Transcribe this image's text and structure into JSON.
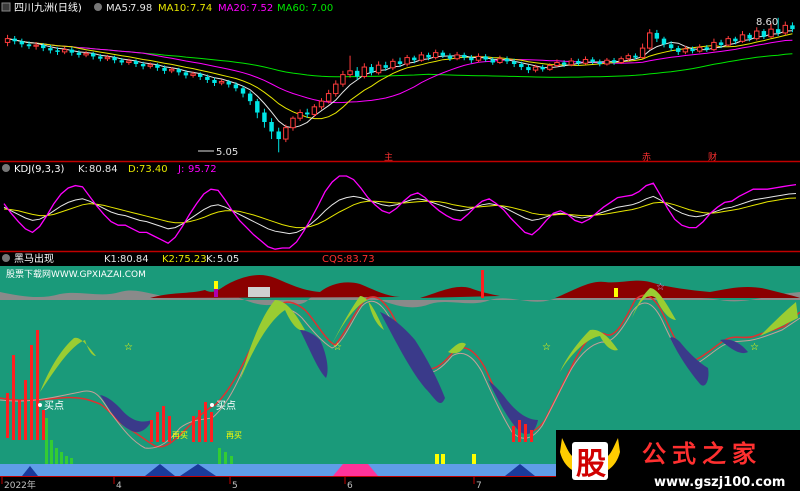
{
  "colors": {
    "up": "#ff3c3c",
    "down": "#00e6e6",
    "ma5": "#e6e6e6",
    "ma10": "#e6e600",
    "ma20": "#ff00ff",
    "ma60": "#00e600",
    "divider": "#c00000",
    "teal": "#1a9a7a",
    "maroon": "#8b0000"
  },
  "price_panel": {
    "security": "四川九洲(日线)",
    "ma_labels": [
      {
        "name": "MA5:",
        "value": "7.98"
      },
      {
        "name": "MA10:",
        "value": "7.74"
      },
      {
        "name": "MA20:",
        "value": "7.52"
      },
      {
        "name": "MA60:",
        "value": "7.00"
      }
    ],
    "high_label": "8.60",
    "low_label": "5.05",
    "markers": [
      "主",
      "赤",
      "财"
    ]
  },
  "kdj_panel": {
    "title": "KDJ(9,3,3)",
    "values": [
      {
        "name": "K:",
        "value": "80.84"
      },
      {
        "name": "D:",
        "value": "73.40"
      },
      {
        "name": "J:",
        "value": "95.72"
      }
    ]
  },
  "horse_panel": {
    "title": "黑马出现",
    "values": [
      {
        "name": "K1:",
        "value": "80.84"
      },
      {
        "name": "K2:",
        "value": "75.23"
      },
      {
        "name": "K:",
        "value": "5.05"
      },
      {
        "name": "CQS:",
        "value": "83.73"
      }
    ],
    "source": "股票下载网WWW.GPXIAZAI.COM",
    "buy_labels": [
      "买点",
      "买点"
    ],
    "small_labels": [
      "再买",
      "再买"
    ]
  },
  "x_axis": {
    "labels": [
      "2022年",
      "4",
      "5",
      "6",
      "7"
    ]
  },
  "watermark": {
    "logo_char": "股",
    "name": "公式之家",
    "url": "www.gszj100.com"
  },
  "chart_data": [
    {
      "type": "candlestick",
      "security": "四川九洲(日线)",
      "period": "日线",
      "indicators": {
        "MA5": 7.98,
        "MA10": 7.74,
        "MA20": 7.52,
        "MA60": 7.0
      },
      "ylim": [
        4.9,
        8.7
      ],
      "annotations": [
        {
          "label": "8.60",
          "value": 8.6
        },
        {
          "label": "5.05",
          "value": 5.05
        }
      ],
      "candles": [
        [
          7.95,
          8.05,
          8.15,
          7.85
        ],
        [
          8.05,
          7.98,
          8.12,
          7.9
        ],
        [
          7.98,
          7.9,
          8.05,
          7.82
        ],
        [
          7.9,
          7.85,
          7.98,
          7.78
        ],
        [
          7.85,
          7.88,
          7.96,
          7.76
        ],
        [
          7.88,
          7.8,
          7.93,
          7.72
        ],
        [
          7.8,
          7.74,
          7.88,
          7.66
        ],
        [
          7.74,
          7.7,
          7.82,
          7.62
        ],
        [
          7.7,
          7.76,
          7.84,
          7.64
        ],
        [
          7.76,
          7.68,
          7.82,
          7.6
        ],
        [
          7.68,
          7.62,
          7.74,
          7.55
        ],
        [
          7.62,
          7.66,
          7.72,
          7.56
        ],
        [
          7.66,
          7.58,
          7.7,
          7.5
        ],
        [
          7.58,
          7.52,
          7.64,
          7.45
        ],
        [
          7.52,
          7.56,
          7.62,
          7.46
        ],
        [
          7.56,
          7.48,
          7.6,
          7.4
        ],
        [
          7.48,
          7.42,
          7.54,
          7.35
        ],
        [
          7.42,
          7.46,
          7.52,
          7.36
        ],
        [
          7.46,
          7.38,
          7.5,
          7.3
        ],
        [
          7.38,
          7.32,
          7.44,
          7.24
        ],
        [
          7.32,
          7.36,
          7.42,
          7.26
        ],
        [
          7.36,
          7.28,
          7.4,
          7.2
        ],
        [
          7.28,
          7.2,
          7.34,
          7.12
        ],
        [
          7.2,
          7.24,
          7.3,
          7.14
        ],
        [
          7.24,
          7.16,
          7.28,
          7.08
        ],
        [
          7.16,
          7.08,
          7.22,
          7.0
        ],
        [
          7.08,
          7.12,
          7.18,
          7.02
        ],
        [
          7.12,
          7.04,
          7.16,
          6.96
        ],
        [
          7.04,
          6.96,
          7.1,
          6.88
        ],
        [
          6.96,
          6.88,
          7.02,
          6.8
        ],
        [
          6.88,
          6.92,
          6.98,
          6.82
        ],
        [
          6.92,
          6.84,
          6.96,
          6.76
        ],
        [
          6.84,
          6.74,
          6.9,
          6.66
        ],
        [
          6.74,
          6.6,
          6.8,
          6.5
        ],
        [
          6.6,
          6.4,
          6.66,
          6.3
        ],
        [
          6.4,
          6.1,
          6.46,
          5.95
        ],
        [
          6.1,
          5.85,
          6.2,
          5.7
        ],
        [
          5.85,
          5.6,
          5.95,
          5.4
        ],
        [
          5.6,
          5.4,
          5.7,
          5.05
        ],
        [
          5.4,
          5.7,
          5.78,
          5.32
        ],
        [
          5.7,
          5.95,
          6.0,
          5.62
        ],
        [
          5.95,
          6.1,
          6.18,
          5.88
        ],
        [
          6.1,
          6.05,
          6.2,
          5.96
        ],
        [
          6.05,
          6.25,
          6.32,
          5.98
        ],
        [
          6.25,
          6.4,
          6.48,
          6.18
        ],
        [
          6.4,
          6.6,
          6.7,
          6.34
        ],
        [
          6.6,
          6.85,
          6.95,
          6.52
        ],
        [
          6.85,
          7.1,
          7.2,
          6.78
        ],
        [
          7.1,
          7.2,
          7.6,
          7.02
        ],
        [
          7.2,
          7.05,
          7.3,
          6.96
        ],
        [
          7.05,
          7.3,
          7.4,
          7.0
        ],
        [
          7.3,
          7.15,
          7.38,
          7.08
        ],
        [
          7.15,
          7.35,
          7.45,
          7.1
        ],
        [
          7.35,
          7.28,
          7.44,
          7.2
        ],
        [
          7.28,
          7.45,
          7.52,
          7.22
        ],
        [
          7.45,
          7.38,
          7.55,
          7.3
        ],
        [
          7.38,
          7.55,
          7.62,
          7.32
        ],
        [
          7.55,
          7.48,
          7.6,
          7.4
        ],
        [
          7.48,
          7.62,
          7.7,
          7.44
        ],
        [
          7.62,
          7.55,
          7.68,
          7.48
        ],
        [
          7.55,
          7.68,
          7.76,
          7.5
        ],
        [
          7.68,
          7.6,
          7.74,
          7.54
        ],
        [
          7.6,
          7.52,
          7.66,
          7.46
        ],
        [
          7.52,
          7.62,
          7.7,
          7.48
        ],
        [
          7.62,
          7.55,
          7.68,
          7.48
        ],
        [
          7.55,
          7.48,
          7.62,
          7.4
        ],
        [
          7.48,
          7.58,
          7.66,
          7.42
        ],
        [
          7.58,
          7.5,
          7.64,
          7.44
        ],
        [
          7.5,
          7.42,
          7.56,
          7.36
        ],
        [
          7.42,
          7.52,
          7.6,
          7.38
        ],
        [
          7.52,
          7.45,
          7.58,
          7.38
        ],
        [
          7.45,
          7.38,
          7.52,
          7.3
        ],
        [
          7.38,
          7.3,
          7.44,
          7.22
        ],
        [
          7.3,
          7.22,
          7.36,
          7.14
        ],
        [
          7.22,
          7.3,
          7.36,
          7.16
        ],
        [
          7.3,
          7.24,
          7.36,
          7.18
        ],
        [
          7.24,
          7.34,
          7.4,
          7.2
        ],
        [
          7.34,
          7.42,
          7.5,
          7.3
        ],
        [
          7.42,
          7.36,
          7.48,
          7.3
        ],
        [
          7.36,
          7.46,
          7.54,
          7.32
        ],
        [
          7.46,
          7.4,
          7.52,
          7.34
        ],
        [
          7.4,
          7.5,
          7.58,
          7.36
        ],
        [
          7.5,
          7.44,
          7.56,
          7.38
        ],
        [
          7.44,
          7.38,
          7.5,
          7.32
        ],
        [
          7.38,
          7.48,
          7.54,
          7.34
        ],
        [
          7.48,
          7.42,
          7.54,
          7.36
        ],
        [
          7.42,
          7.52,
          7.58,
          7.38
        ],
        [
          7.52,
          7.6,
          7.66,
          7.46
        ],
        [
          7.6,
          7.55,
          7.66,
          7.5
        ],
        [
          7.55,
          7.8,
          7.92,
          7.52
        ],
        [
          7.8,
          8.2,
          8.3,
          7.76
        ],
        [
          8.2,
          8.05,
          8.28,
          7.96
        ],
        [
          8.05,
          7.9,
          8.1,
          7.82
        ],
        [
          7.9,
          7.8,
          7.98,
          7.72
        ],
        [
          7.8,
          7.7,
          7.86,
          7.62
        ],
        [
          7.7,
          7.78,
          7.86,
          7.64
        ],
        [
          7.78,
          7.72,
          7.84,
          7.66
        ],
        [
          7.72,
          7.82,
          7.9,
          7.68
        ],
        [
          7.82,
          7.76,
          7.88,
          7.7
        ],
        [
          7.76,
          7.95,
          8.05,
          7.72
        ],
        [
          7.95,
          7.88,
          8.02,
          7.8
        ],
        [
          7.88,
          8.05,
          8.12,
          7.84
        ],
        [
          8.05,
          7.98,
          8.1,
          7.9
        ],
        [
          7.98,
          8.15,
          8.25,
          7.94
        ],
        [
          8.15,
          8.05,
          8.2,
          7.98
        ],
        [
          8.05,
          8.25,
          8.35,
          8.0
        ],
        [
          8.25,
          8.1,
          8.3,
          8.04
        ],
        [
          8.1,
          8.3,
          8.45,
          8.06
        ],
        [
          8.3,
          8.2,
          8.6,
          8.12
        ],
        [
          8.2,
          8.4,
          8.5,
          8.14
        ],
        [
          8.4,
          8.3,
          8.48,
          8.22
        ]
      ]
    },
    {
      "type": "line",
      "title": "KDJ(9,3,3)",
      "ylim": [
        -10,
        110
      ],
      "series": [
        {
          "name": "K",
          "values": [
            58,
            52,
            46,
            40,
            36,
            38,
            44,
            52,
            60,
            66,
            70,
            72,
            68,
            62,
            56,
            50,
            46,
            44,
            40,
            36,
            34,
            30,
            26,
            22,
            24,
            30,
            38,
            46,
            54,
            60,
            62,
            58,
            52,
            46,
            40,
            34,
            28,
            22,
            18,
            16,
            14,
            16,
            22,
            30,
            40,
            52,
            62,
            70,
            74,
            76,
            74,
            70,
            66,
            62,
            60,
            62,
            66,
            70,
            72,
            70,
            66,
            62,
            58,
            54,
            52,
            54,
            58,
            62,
            64,
            62,
            58,
            52,
            46,
            40,
            36,
            38,
            42,
            46,
            48,
            46,
            42,
            40,
            42,
            46,
            50,
            54,
            58,
            60,
            62,
            66,
            72,
            76,
            70,
            62,
            54,
            48,
            44,
            42,
            44,
            48,
            52,
            56,
            58,
            62,
            66,
            70,
            72,
            74,
            76,
            78,
            80,
            80.84
          ]
        },
        {
          "name": "D",
          "values": [
            55,
            54,
            52,
            49,
            46,
            44,
            44,
            46,
            50,
            54,
            58,
            62,
            64,
            63,
            61,
            58,
            55,
            52,
            49,
            46,
            43,
            40,
            37,
            34,
            32,
            32,
            34,
            37,
            41,
            46,
            50,
            52,
            52,
            51,
            48,
            45,
            41,
            37,
            33,
            29,
            26,
            24,
            24,
            26,
            30,
            36,
            43,
            50,
            56,
            62,
            66,
            68,
            68,
            67,
            66,
            65,
            65,
            66,
            67,
            68,
            68,
            67,
            65,
            62,
            60,
            58,
            58,
            59,
            60,
            61,
            60,
            58,
            55,
            52,
            48,
            46,
            45,
            45,
            46,
            46,
            45,
            44,
            44,
            45,
            46,
            48,
            50,
            52,
            54,
            57,
            61,
            65,
            66,
            65,
            62,
            58,
            54,
            51,
            49,
            48,
            49,
            51,
            53,
            55,
            58,
            61,
            64,
            67,
            69,
            71,
            73,
            73.4
          ]
        },
        {
          "name": "J",
          "values": [
            64,
            48,
            34,
            22,
            16,
            26,
            44,
            64,
            80,
            90,
            94,
            92,
            76,
            60,
            46,
            34,
            28,
            28,
            22,
            16,
            16,
            10,
            4,
            -2,
            8,
            26,
            46,
            64,
            80,
            88,
            86,
            70,
            52,
            36,
            24,
            12,
            2,
            -8,
            -12,
            -10,
            -10,
            0,
            18,
            38,
            60,
            84,
            100,
            110,
            110,
            104,
            90,
            74,
            62,
            52,
            48,
            56,
            68,
            78,
            82,
            74,
            62,
            52,
            44,
            38,
            36,
            46,
            58,
            68,
            72,
            64,
            54,
            40,
            28,
            16,
            12,
            22,
            36,
            48,
            52,
            46,
            36,
            32,
            38,
            48,
            58,
            66,
            74,
            76,
            78,
            84,
            94,
            98,
            78,
            56,
            38,
            28,
            24,
            24,
            34,
            48,
            58,
            66,
            68,
            76,
            82,
            88,
            88,
            88,
            90,
            92,
            94,
            95.72
          ]
        }
      ]
    }
  ]
}
